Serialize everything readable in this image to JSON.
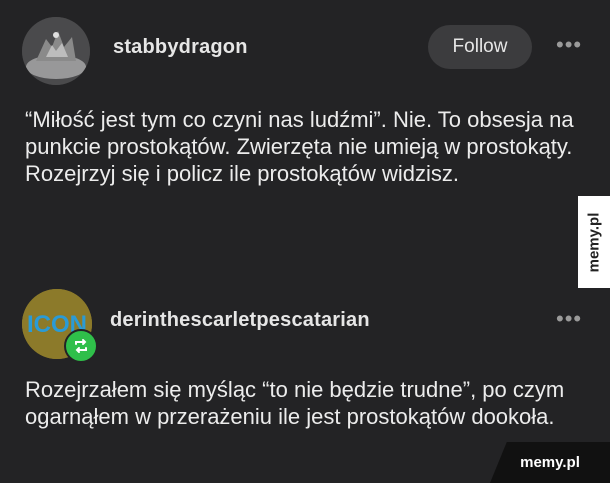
{
  "post1": {
    "username": "stabbydragon",
    "follow_label": "Follow",
    "more_label": "•••",
    "text": "“Miłość jest tym co czyni nas ludźmi”. Nie. To obsesja na punkcie prostokątów. Zwierzęta nie umieją w prostokąty. Rozejrzyj się i policz ile prostokątów widzisz."
  },
  "post2": {
    "username": "derinthescarletpescatarian",
    "avatar_text": "ICON",
    "more_label": "•••",
    "text": "Rozejrzałem się myśląc “to nie będzie trudne”, po czym ogarnąłem w przerażeniu ile jest prostokątów dookoła."
  },
  "watermarks": {
    "side": "memy.pl",
    "bottom": "memy.pl"
  },
  "colors": {
    "background": "#232325",
    "reblog_badge": "#2fbf4a",
    "follow_button": "#3c3c3e"
  }
}
